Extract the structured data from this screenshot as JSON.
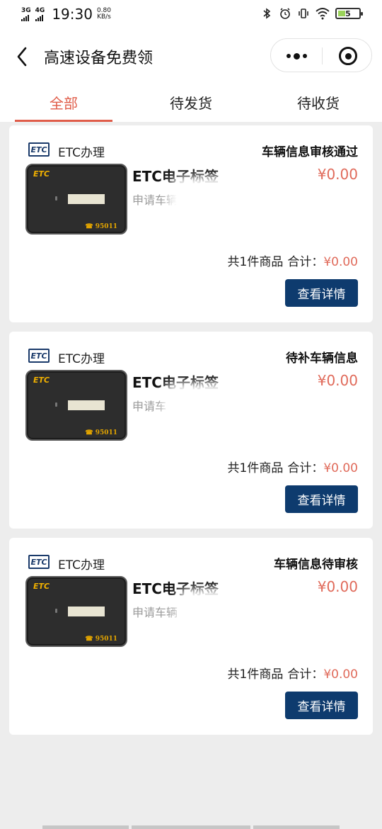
{
  "status_bar": {
    "sim1": "3G",
    "sim2": "4G",
    "time": "19:30",
    "speed_value": "0.80",
    "speed_unit": "KB/s",
    "battery": "5"
  },
  "navbar": {
    "title": "高速设备免费领"
  },
  "tabs": [
    {
      "label": "全部",
      "active": true
    },
    {
      "label": "待发货",
      "active": false
    },
    {
      "label": "待收货",
      "active": false
    }
  ],
  "orders": [
    {
      "shop_logo": "ETC",
      "shop_name": "ETC办理",
      "status": "车辆信息审核通过",
      "device_brand": "ETC",
      "device_phone": "☎ 95011",
      "product_title": "ETC电子标签",
      "product_price": "¥0.00",
      "product_sub": "申请车辆",
      "summary_count": "共1件商品",
      "summary_label": "合计：",
      "summary_total": "¥0.00",
      "button_label": "查看详情"
    },
    {
      "shop_logo": "ETC",
      "shop_name": "ETC办理",
      "status": "待补车辆信息",
      "device_brand": "ETC",
      "device_phone": "☎ 95011",
      "product_title": "ETC电子标签",
      "product_price": "¥0.00",
      "product_sub": "申请车",
      "summary_count": "共1件商品",
      "summary_label": "合计：",
      "summary_total": "¥0.00",
      "button_label": "查看详情"
    },
    {
      "shop_logo": "ETC",
      "shop_name": "ETC办理",
      "status": "车辆信息待审核",
      "device_brand": "ETC",
      "device_phone": "☎ 95011",
      "product_title": "ETC电子标签",
      "product_price": "¥0.00",
      "product_sub": "申请车辆",
      "summary_count": "共1件商品",
      "summary_label": "合计：",
      "summary_total": "¥0.00",
      "button_label": "查看详情"
    }
  ],
  "colors": {
    "accent": "#e05d4a",
    "price": "#e06a5a",
    "button": "#0e3b6e",
    "background": "#ededed"
  },
  "icons": {
    "back": "chevron-left-icon",
    "more": "more-dots-icon",
    "close": "mini-program-close-icon",
    "bluetooth": "bluetooth-icon",
    "alarm": "alarm-icon",
    "vibrate": "vibrate-icon",
    "wifi": "wifi-icon",
    "battery": "battery-icon"
  }
}
